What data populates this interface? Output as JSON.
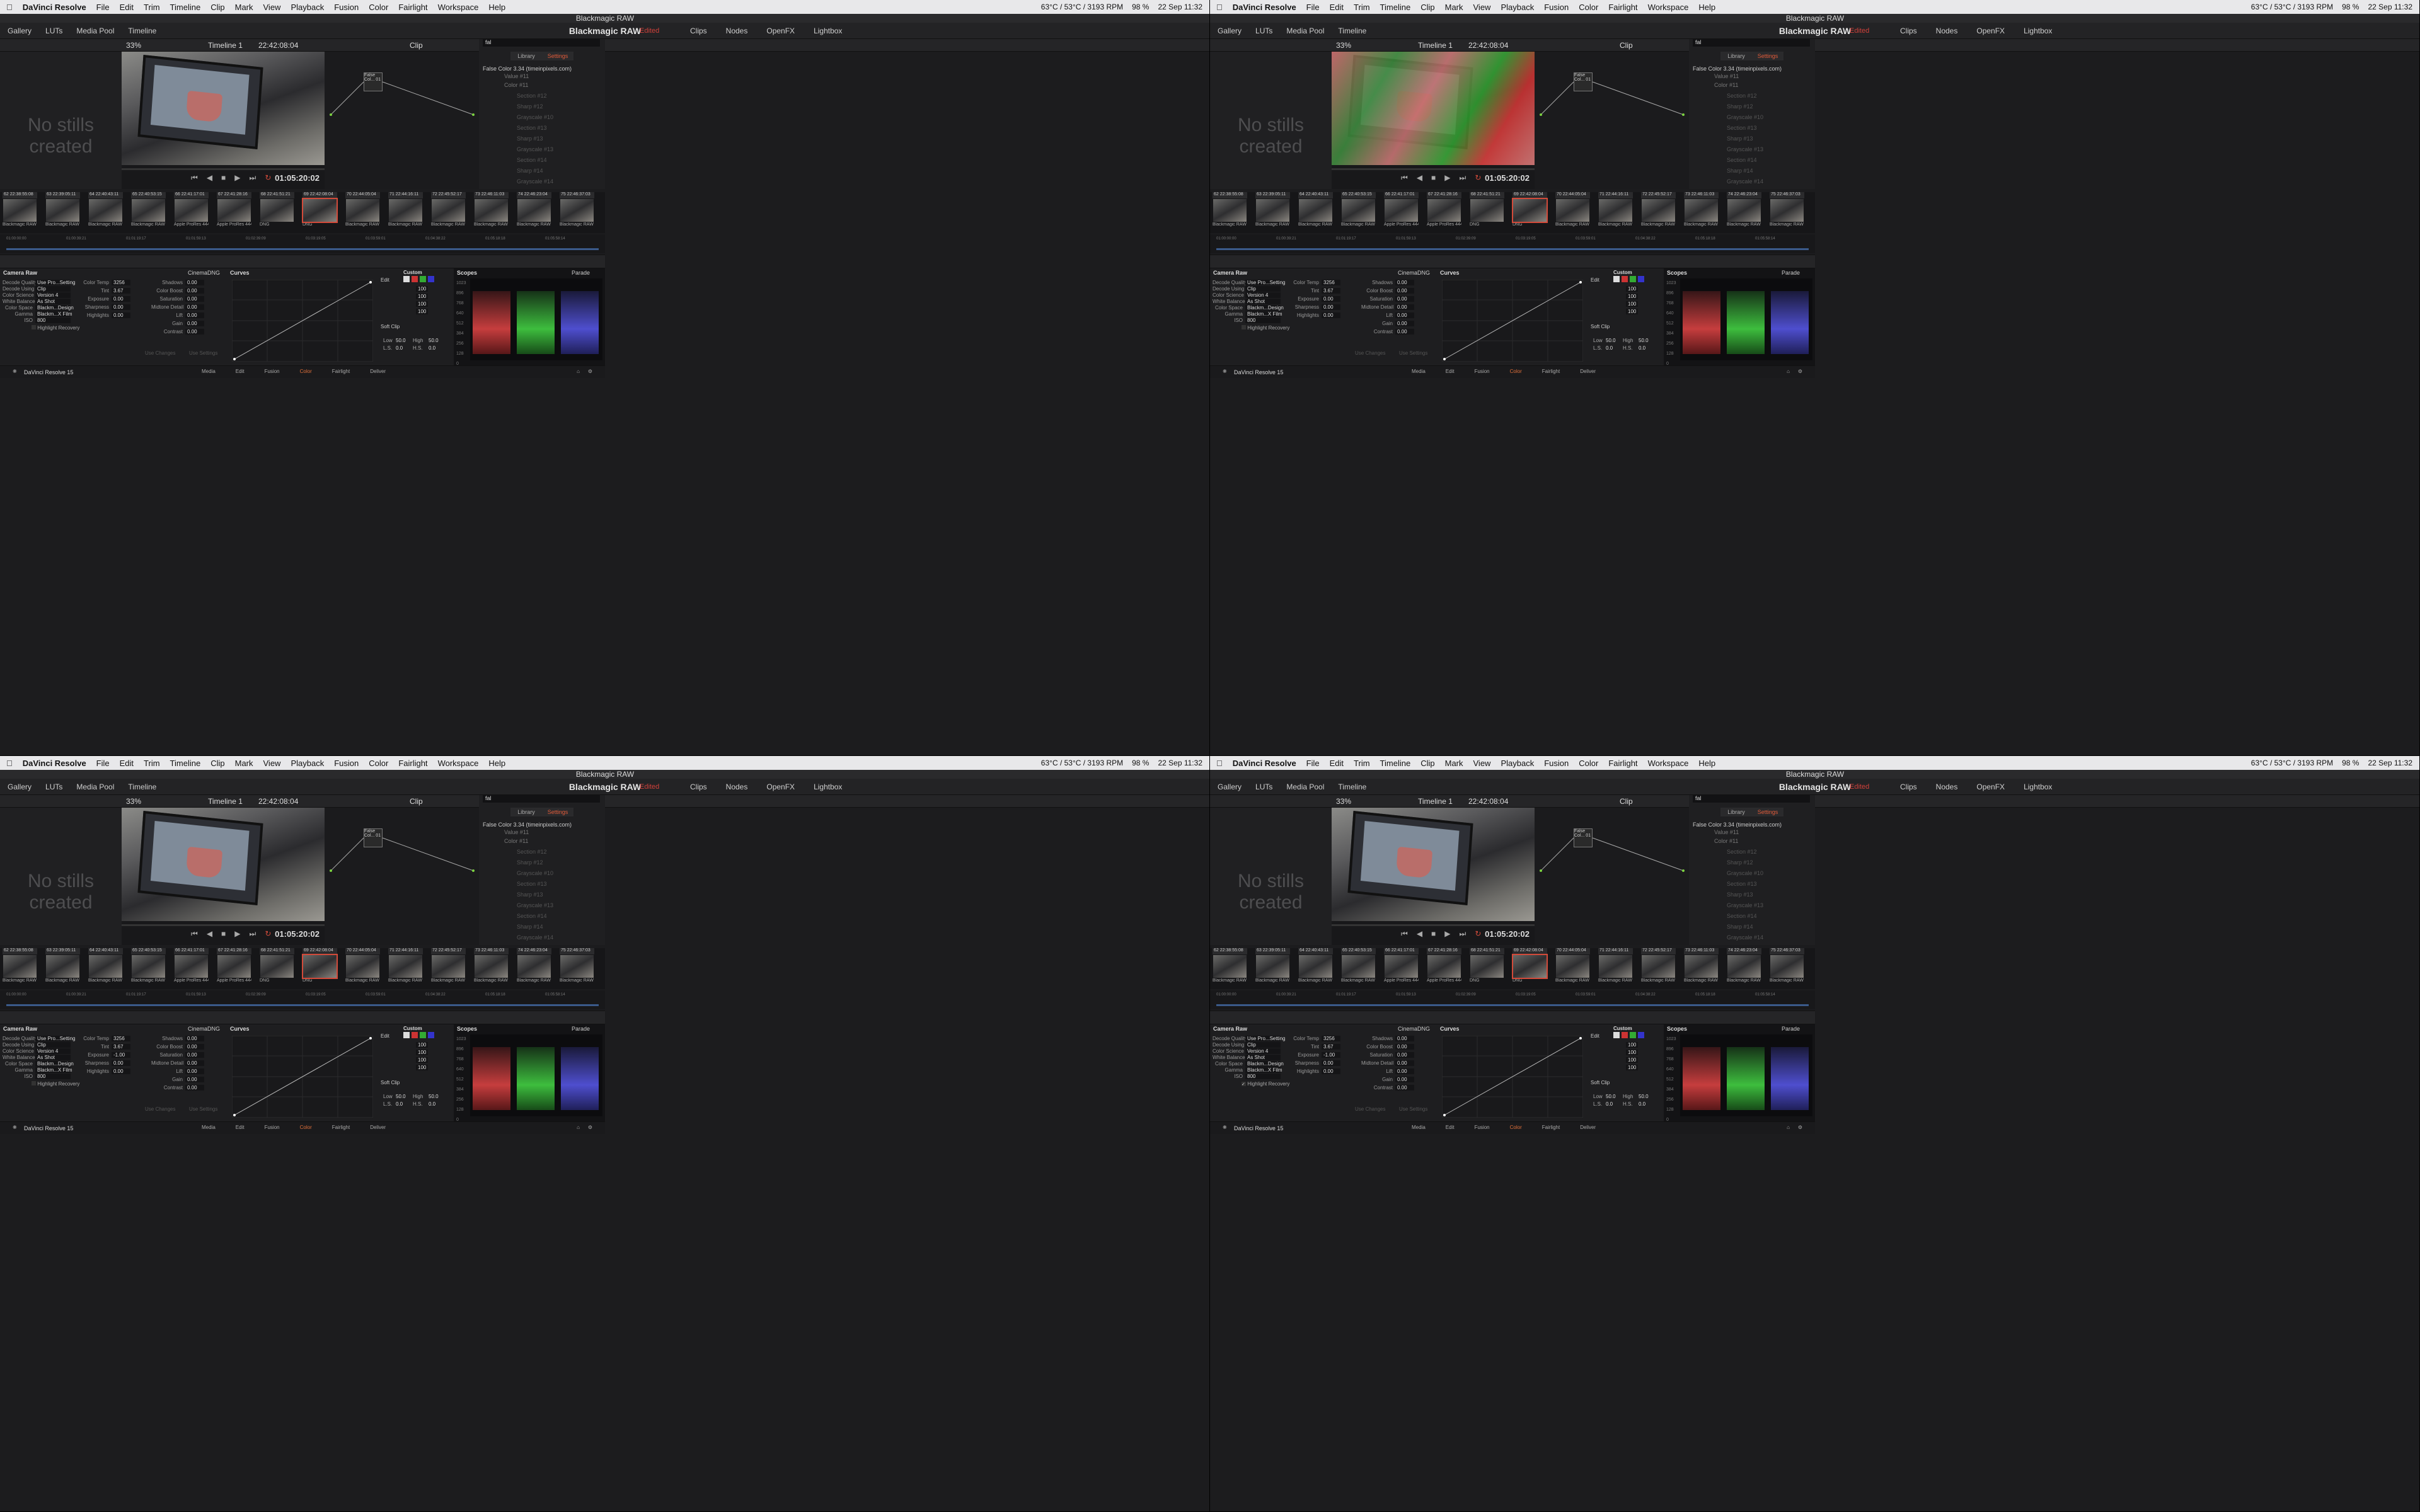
{
  "menubar": {
    "app_name": "DaVinci Resolve",
    "items": [
      "File",
      "Edit",
      "Trim",
      "Timeline",
      "Clip",
      "Mark",
      "View",
      "Playback",
      "Fusion",
      "Color",
      "Fairlight",
      "Workspace",
      "Help"
    ],
    "status": [
      "63°C / 53°C / 3193 RPM",
      "98 %",
      "22 Sep 11:32"
    ]
  },
  "window_title": "Blackmagic RAW",
  "project_title": "Blackmagic RAW",
  "edited_label": "Edited",
  "top_tabs_left": [
    "Gallery",
    "LUTs",
    "Media Pool",
    "Timeline"
  ],
  "top_tabs_right": [
    "Clips",
    "Nodes",
    "OpenFX",
    "Lightbox"
  ],
  "viewer": {
    "zoom": "33%",
    "timeline": "Timeline 1",
    "timecode": "22:42:08:04",
    "playhead_tc": "01:05:20:02",
    "clip_mode": "Clip"
  },
  "gallery_empty": "No stills created",
  "library": {
    "search": "fal",
    "tab_library": "Library",
    "tab_settings": "Settings",
    "effect": "False Color 3.34 (timeinpixels.com)",
    "value_label": "Value #11",
    "color_label": "Color #11",
    "rows": [
      "Section #12",
      "Sharp #12",
      "Grayscale #10",
      "Section #13",
      "Sharp #13",
      "Grayscale #13",
      "Section #14",
      "Sharp #14",
      "Grayscale #14"
    ]
  },
  "node_label": "False Col...",
  "node_num": "01",
  "clips": [
    {
      "n": "62",
      "tc": "22:38:55:08",
      "fmt": "Blackmagic RAW"
    },
    {
      "n": "63",
      "tc": "22:39:05:11",
      "fmt": "Blackmagic RAW"
    },
    {
      "n": "64",
      "tc": "22:40:43:11",
      "fmt": "Blackmagic RAW"
    },
    {
      "n": "65",
      "tc": "22:40:53:15",
      "fmt": "Blackmagic RAW"
    },
    {
      "n": "66",
      "tc": "22:41:17:01",
      "fmt": "Apple ProRes 4444 XQ"
    },
    {
      "n": "67",
      "tc": "22:41:28:16",
      "fmt": "Apple ProRes 4444 XQ"
    },
    {
      "n": "68",
      "tc": "22:41:51:21",
      "fmt": "DNG"
    },
    {
      "n": "69",
      "tc": "22:42:08:04",
      "fmt": "DNG"
    },
    {
      "n": "70",
      "tc": "22:44:05:04",
      "fmt": "Blackmagic RAW"
    },
    {
      "n": "71",
      "tc": "22:44:16:11",
      "fmt": "Blackmagic RAW"
    },
    {
      "n": "72",
      "tc": "22:45:52:17",
      "fmt": "Blackmagic RAW"
    },
    {
      "n": "73",
      "tc": "22:46:11:03",
      "fmt": "Blackmagic RAW"
    },
    {
      "n": "74",
      "tc": "22:46:23:04",
      "fmt": "Blackmagic RAW"
    },
    {
      "n": "75",
      "tc": "22:46:37:03",
      "fmt": "Blackmagic RAW"
    }
  ],
  "ruler": [
    "01:00:00:00",
    "01:00:39:21",
    "01:01:19:17",
    "01:01:59:13",
    "01:02:39:09",
    "01:03:19:05",
    "01:03:59:01",
    "01:04:38:22",
    "01:05:18:18",
    "01:05:58:14"
  ],
  "camera_raw": {
    "title": "Camera Raw",
    "format": "CinemaDNG",
    "left": [
      [
        "Decode Quality",
        "Use Pro...Setting"
      ],
      [
        "Decode Using",
        "Clip"
      ],
      [
        "Color Science",
        "Version 4"
      ],
      [
        "White Balance",
        "As Shot"
      ],
      [
        "Color Space",
        "Blackm...Design"
      ],
      [
        "Gamma",
        "Blackm...X Film"
      ],
      [
        "ISO",
        "800"
      ]
    ],
    "mid": [
      [
        "Color Temp",
        "3256"
      ],
      [
        "Tint",
        "3.67"
      ],
      [
        "Exposure",
        "0.00"
      ],
      [
        "Sharpness",
        "0.00"
      ],
      [
        "Highlights",
        "0.00"
      ]
    ],
    "right": [
      [
        "Shadows",
        "0.00"
      ],
      [
        "Color Boost",
        "0.00"
      ],
      [
        "Saturation",
        "0.00"
      ],
      [
        "Midtone Detail",
        "0.00"
      ],
      [
        "Lift",
        "0.00"
      ],
      [
        "Gain",
        "0.00"
      ],
      [
        "Contrast",
        "0.00"
      ]
    ],
    "highlight": "Highlight Recovery",
    "use_changes": "Use Changes",
    "use_settings": "Use Settings"
  },
  "curves": {
    "title": "Curves",
    "custom": "Custom",
    "edit": "Edit",
    "values": [
      "100",
      "100",
      "100",
      "100"
    ],
    "soft_clip": "Soft Clip",
    "low": "Low",
    "low_v": "50.0",
    "high": "High",
    "high_v": "50.0",
    "ls": "L.S.",
    "ls_v": "0.0",
    "hs": "H.S.",
    "hs_v": "0.0"
  },
  "scopes": {
    "title": "Scopes",
    "mode": "Parade",
    "ticks": [
      "1023",
      "896",
      "768",
      "640",
      "512",
      "384",
      "256",
      "128",
      "0"
    ]
  },
  "pages": {
    "app": "DaVinci Resolve 15",
    "tabs": [
      "Media",
      "Edit",
      "Fusion",
      "Color",
      "Fairlight",
      "Deliver"
    ],
    "active": "Color"
  },
  "quadrants": [
    {
      "exposure": "0.00",
      "false_color": false,
      "highlight_checked": false
    },
    {
      "exposure": "0.00",
      "false_color": true,
      "highlight_checked": false
    },
    {
      "exposure": "-1.00",
      "false_color": false,
      "highlight_checked": false
    },
    {
      "exposure": "-1.00",
      "false_color": false,
      "highlight_checked": true
    }
  ]
}
